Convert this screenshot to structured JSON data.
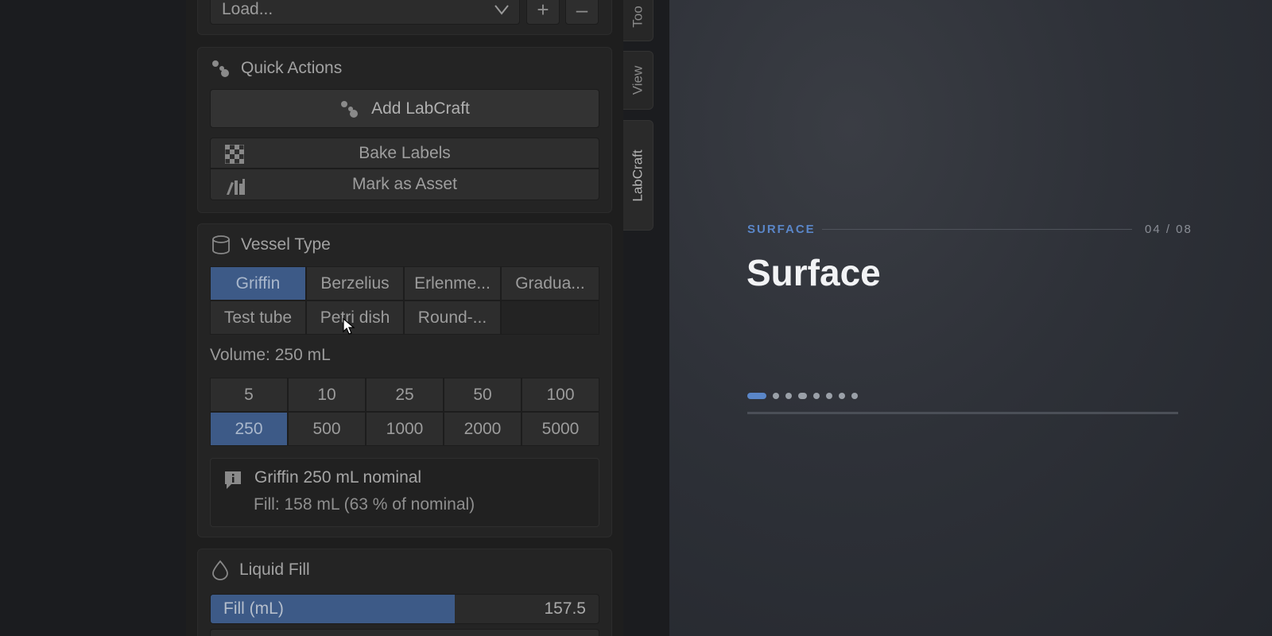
{
  "preset": {
    "load_label": "Load...",
    "add_label": "+",
    "remove_label": "–"
  },
  "quick_actions": {
    "title": "Quick Actions",
    "add_button": "Add LabCraft",
    "bake_labels": "Bake Labels",
    "mark_asset": "Mark as Asset"
  },
  "vessel_type": {
    "title": "Vessel Type",
    "options": [
      "Griffin",
      "Berzelius",
      "Erlenme...",
      "Gradua...",
      "Test tube",
      "Petri dish",
      "Round-..."
    ],
    "selected": "Griffin",
    "volume_label": "Volume: 250 mL",
    "volumes": [
      "5",
      "10",
      "25",
      "50",
      "100",
      "250",
      "500",
      "1000",
      "2000",
      "5000"
    ],
    "selected_volume": "250",
    "info_title": "Griffin 250 mL nominal",
    "info_detail": "Fill: 158 mL (63 % of nominal)"
  },
  "liquid_fill": {
    "title": "Liquid Fill",
    "field_label": "Fill (mL)",
    "field_value": "157.5",
    "fill_fraction": 0.63
  },
  "tabs": [
    "Too",
    "View",
    "LabCraft"
  ],
  "active_tab": "LabCraft",
  "stage": {
    "kicker": "SURFACE",
    "counter": "04 / 08",
    "title": "Surface",
    "slides_total": 8,
    "current_slide": 1
  },
  "colors": {
    "accent": "#5a86c8",
    "selected_cell": "#3d5a87",
    "panel": "#242424"
  }
}
